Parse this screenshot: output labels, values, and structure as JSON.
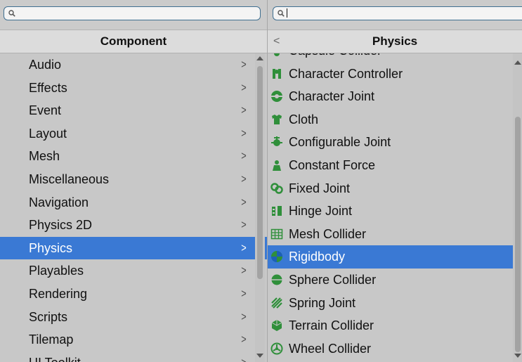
{
  "left": {
    "search_value": "",
    "header": "Component",
    "items": [
      {
        "label": "Audio"
      },
      {
        "label": "Effects"
      },
      {
        "label": "Event"
      },
      {
        "label": "Layout"
      },
      {
        "label": "Mesh"
      },
      {
        "label": "Miscellaneous"
      },
      {
        "label": "Navigation"
      },
      {
        "label": "Physics 2D"
      },
      {
        "label": "Physics",
        "selected": true
      },
      {
        "label": "Playables"
      },
      {
        "label": "Rendering"
      },
      {
        "label": "Scripts"
      },
      {
        "label": "Tilemap"
      },
      {
        "label": "UI Toolkit"
      }
    ],
    "chevron": ">"
  },
  "right": {
    "search_value": "",
    "back": "<",
    "header": "Physics",
    "items": [
      {
        "label": "Capsule Collider",
        "icon": "capsule-collider-icon"
      },
      {
        "label": "Character Controller",
        "icon": "character-controller-icon"
      },
      {
        "label": "Character Joint",
        "icon": "character-joint-icon"
      },
      {
        "label": "Cloth",
        "icon": "cloth-icon"
      },
      {
        "label": "Configurable Joint",
        "icon": "configurable-joint-icon"
      },
      {
        "label": "Constant Force",
        "icon": "constant-force-icon"
      },
      {
        "label": "Fixed Joint",
        "icon": "fixed-joint-icon"
      },
      {
        "label": "Hinge Joint",
        "icon": "hinge-joint-icon"
      },
      {
        "label": "Mesh Collider",
        "icon": "mesh-collider-icon"
      },
      {
        "label": "Rigidbody",
        "icon": "rigidbody-icon",
        "selected": true
      },
      {
        "label": "Sphere Collider",
        "icon": "sphere-collider-icon"
      },
      {
        "label": "Spring Joint",
        "icon": "spring-joint-icon"
      },
      {
        "label": "Terrain Collider",
        "icon": "terrain-collider-icon"
      },
      {
        "label": "Wheel Collider",
        "icon": "wheel-collider-icon"
      }
    ]
  },
  "colors": {
    "selection": "#3a79d4",
    "icon_green": "#2f8f3a",
    "search_border": "#3f6f91"
  }
}
